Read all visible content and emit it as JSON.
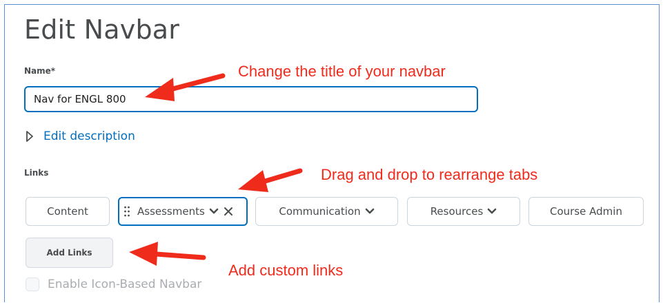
{
  "page": {
    "title": "Edit Navbar"
  },
  "name_field": {
    "label": "Name",
    "required_marker": "*",
    "value": "Nav for ENGL 800"
  },
  "description": {
    "toggle_label": "Edit description"
  },
  "links": {
    "label": "Links",
    "items": [
      {
        "label": "Content",
        "has_dropdown": false,
        "selected": false
      },
      {
        "label": "Assessments",
        "has_dropdown": true,
        "selected": true
      },
      {
        "label": "Communication",
        "has_dropdown": true,
        "selected": false
      },
      {
        "label": "Resources",
        "has_dropdown": true,
        "selected": false
      },
      {
        "label": "Course Admin",
        "has_dropdown": false,
        "selected": false
      }
    ],
    "add_button_label": "Add Links"
  },
  "icon_navbar": {
    "label": "Enable Icon-Based Navbar",
    "checked": false,
    "disabled": true
  },
  "annotations": [
    {
      "text": "Change the title of your navbar"
    },
    {
      "text": "Drag and drop to rearrange tabs"
    },
    {
      "text": "Add custom links"
    }
  ],
  "colors": {
    "accent_blue": "#006fbf",
    "annotation_red": "#ef2b1c",
    "frame_blue": "#5b8fcf"
  }
}
